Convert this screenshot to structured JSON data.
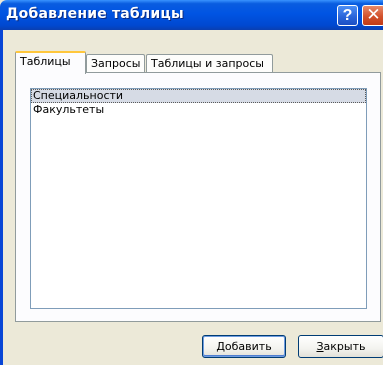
{
  "window": {
    "title": "Добавление таблицы",
    "help_glyph": "?",
    "close_glyph": "✕"
  },
  "tabs": [
    {
      "label": "Таблицы",
      "active": true
    },
    {
      "label": "Запросы",
      "active": false
    },
    {
      "label": "Таблицы и запросы",
      "active": false
    }
  ],
  "list": {
    "items": [
      {
        "label": "Специальности",
        "selected": true
      },
      {
        "label": "Факультеты",
        "selected": false
      }
    ]
  },
  "buttons": {
    "add_label": "Добавить",
    "close_label": "Закрыть"
  },
  "colors": {
    "titlebar": "#0054e3",
    "dialog_bg": "#ece9d8",
    "tab_highlight": "#ffc73c",
    "selection": "#d6dbe5"
  }
}
